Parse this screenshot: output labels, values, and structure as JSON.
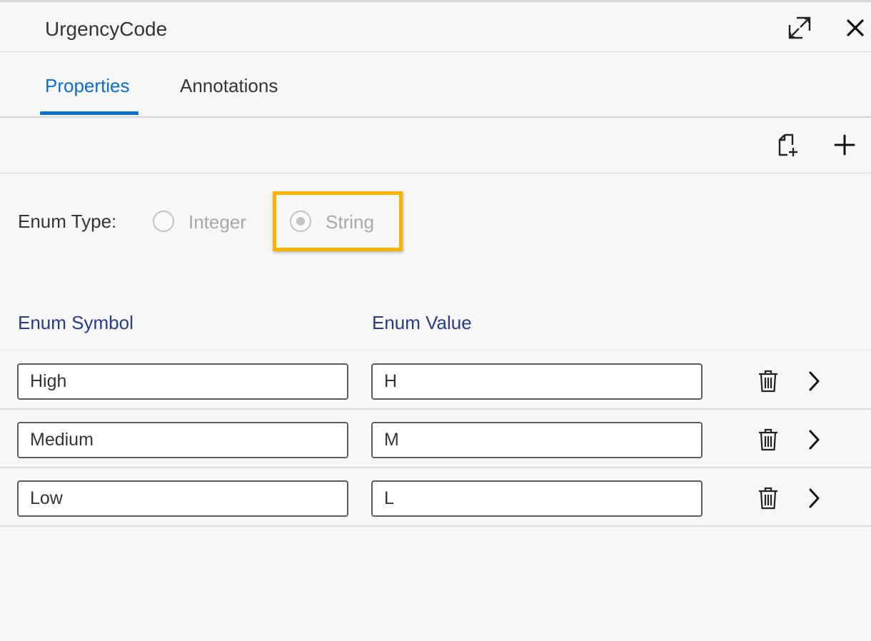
{
  "header": {
    "title": "UrgencyCode",
    "expand_icon": "expand-icon",
    "close_icon": "close-icon"
  },
  "tabs": [
    {
      "label": "Properties",
      "selected": true
    },
    {
      "label": "Annotations",
      "selected": false
    }
  ],
  "toolbar": {
    "copy_icon": "copy-add-icon",
    "add_icon": "plus-icon"
  },
  "enum_type": {
    "label": "Enum Type:",
    "options": [
      {
        "label": "Integer",
        "selected": false,
        "disabled": true
      },
      {
        "label": "String",
        "selected": true,
        "disabled": true
      }
    ],
    "highlight_color": "#f5b400"
  },
  "table": {
    "columns": [
      "Enum Symbol",
      "Enum Value"
    ],
    "rows": [
      {
        "symbol": "High",
        "value": "H"
      },
      {
        "symbol": "Medium",
        "value": "M"
      },
      {
        "symbol": "Low",
        "value": "L"
      }
    ],
    "row_icons": [
      "trash-icon",
      "chevron-right-icon"
    ]
  },
  "colors": {
    "accent": "#0a6ed1",
    "column_header": "#2a3a8c",
    "background": "#f7f7f7"
  }
}
